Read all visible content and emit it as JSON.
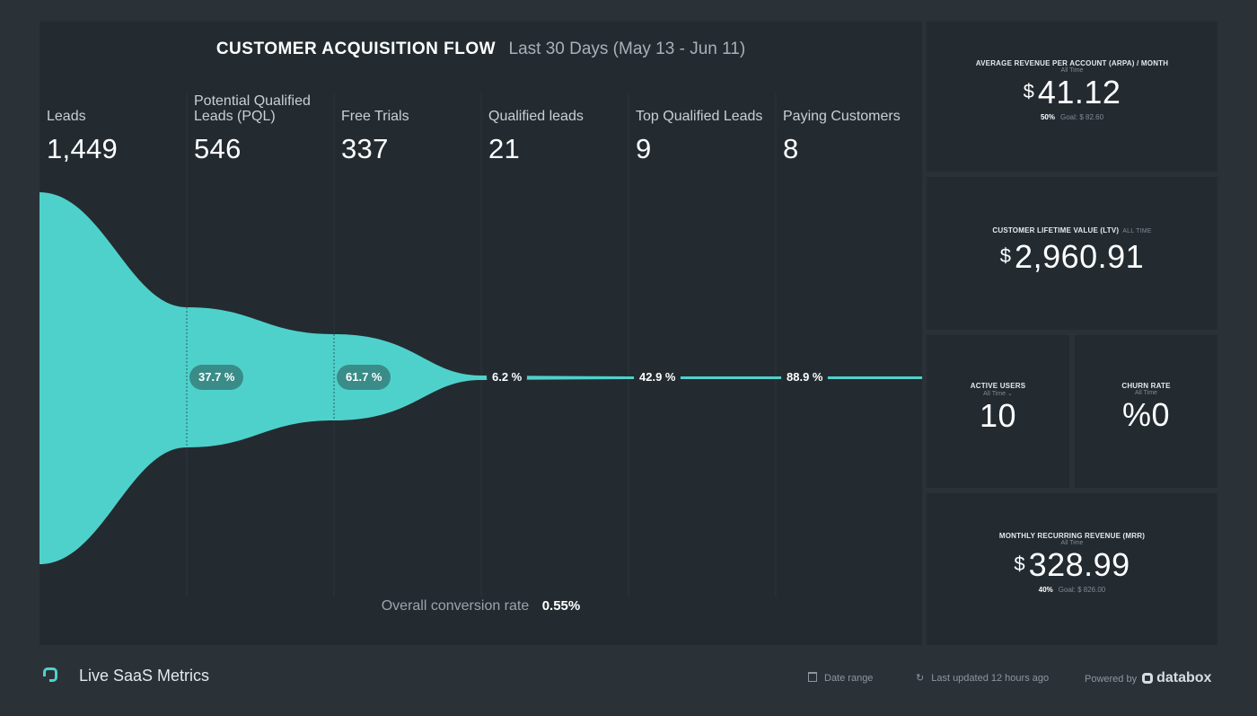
{
  "funnel": {
    "title": "CUSTOMER ACQUISITION FLOW",
    "period": "Last 30 Days (May 13 - Jun 11)",
    "stages": [
      {
        "label": "Leads",
        "value": "1,449"
      },
      {
        "label": "Potential Qualified Leads (PQL)",
        "value": "546"
      },
      {
        "label": "Free Trials",
        "value": "337"
      },
      {
        "label": "Qualified leads",
        "value": "21"
      },
      {
        "label": "Top Qualified Leads",
        "value": "9"
      },
      {
        "label": "Paying Customers",
        "value": "8"
      }
    ],
    "conversions": [
      "37.7 %",
      "61.7 %",
      "6.2 %",
      "42.9 %",
      "88.9 %"
    ],
    "overall_label": "Overall conversion rate",
    "overall_value": "0.55%",
    "color": "#4fd1cb"
  },
  "cards": {
    "arpa": {
      "title": "AVERAGE REVENUE PER ACCOUNT (ARPA) / MONTH",
      "sub": "All Time",
      "currency": "$",
      "value": "41.12",
      "goal_pct": "50%",
      "goal": "Goal: $ 82.60"
    },
    "ltv": {
      "title": "CUSTOMER LIFETIME VALUE (LTV)",
      "sub": "All Time",
      "currency": "$",
      "value": "2,960.91"
    },
    "active_users": {
      "title": "ACTIVE USERS",
      "sub": "All Time",
      "value": "10"
    },
    "churn": {
      "title": "CHURN RATE",
      "sub": "All Time",
      "value": "%0"
    },
    "mrr": {
      "title": "MONTHLY RECURRING REVENUE (MRR)",
      "sub": "All Time",
      "currency": "$",
      "value": "328.99",
      "goal_pct": "40%",
      "goal": "Goal: $ 826.00"
    }
  },
  "footer": {
    "dashboard_name": "Live SaaS Metrics",
    "date_range": "Date range",
    "last_updated": "Last updated 12 hours ago",
    "powered_by": "Powered by",
    "brand": "databox"
  },
  "icons": {
    "logo": "databox-logo-icon",
    "calendar": "calendar-icon",
    "refresh": "refresh-icon",
    "dropdown": "chevron-down-icon"
  }
}
